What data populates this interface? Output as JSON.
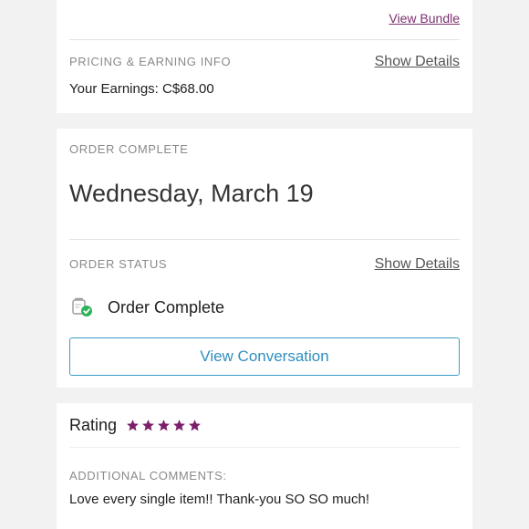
{
  "bundle": {
    "view_bundle_label": "View Bundle"
  },
  "pricing": {
    "section_title": "PRICING & EARNING INFO",
    "show_details_label": "Show Details",
    "earnings_text": "Your Earnings: C$68.00"
  },
  "order": {
    "section_title": "ORDER COMPLETE",
    "date": "Wednesday, March 19",
    "status_section_title": "ORDER STATUS",
    "show_details_label": "Show Details",
    "status_text": "Order Complete",
    "status_icon": "order-complete-check-icon",
    "view_conversation_label": "View Conversation"
  },
  "rating": {
    "label": "Rating",
    "stars": 5,
    "max_stars": 5,
    "star_color": "#7b1f6a",
    "comments_title": "ADDITIONAL COMMENTS:",
    "comments_text": "Love every single item!! Thank-you SO SO much!"
  },
  "colors": {
    "accent_purple": "#7b2f6f",
    "button_blue": "#2f8fbf",
    "check_green": "#2fb35a"
  }
}
